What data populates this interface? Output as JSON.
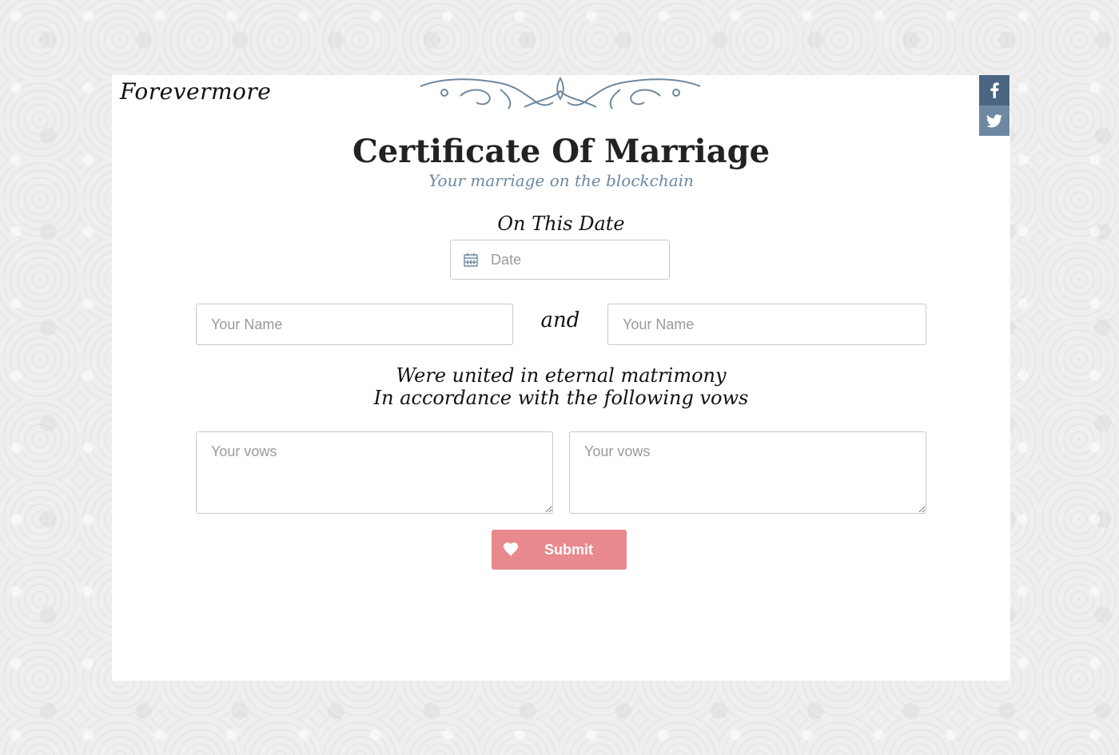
{
  "brand": "Forevermore",
  "social": {
    "facebook_icon": "facebook-icon",
    "twitter_icon": "twitter-icon"
  },
  "certificate": {
    "title": "Certificate Of Marriage",
    "subtitle": "Your marriage on the blockchain",
    "date_heading": "On This Date",
    "date_placeholder": "Date",
    "name_placeholder_left": "Your Name",
    "connector": "and",
    "name_placeholder_right": "Your Name",
    "united_line1": "Were united in eternal matrimony",
    "united_line2": "In accordance with the following vows",
    "vows_placeholder_left": "Your vows",
    "vows_placeholder_right": "Your vows",
    "submit_label": "Submit"
  },
  "colors": {
    "accent_blue": "#6d88a0",
    "submit_pink": "#e8898e",
    "text_dark": "#222222"
  }
}
